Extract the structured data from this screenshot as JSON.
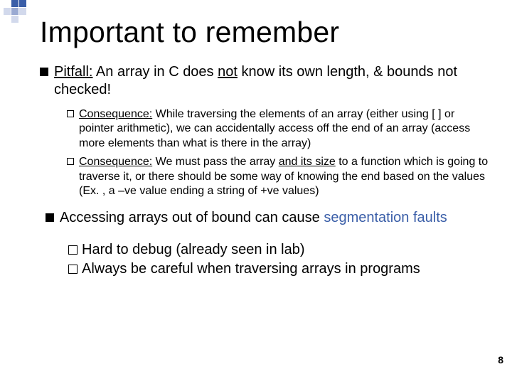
{
  "title": "Important to remember",
  "bullet1": {
    "pre": "Pitfall:",
    "mid1": " An array in C does ",
    "u1": "not",
    "mid2": " know its own length, & bounds not checked!"
  },
  "sub1": {
    "label": "Consequence:",
    "text": " While traversing the elements of an array (either using [ ] or pointer arithmetic), we can accidentally access off the end of an array (access more elements than what is there in the array)"
  },
  "sub2": {
    "label": "Consequence:",
    "pre": " We must pass the array ",
    "u": "and its size",
    "post": " to a function which is going to traverse it, or there should be some way of knowing the end based on the values (Ex. , a –ve value ending a string of +ve values)"
  },
  "bullet2": {
    "pre": " Accessing arrays out of bound can cause ",
    "link": "segmentation faults"
  },
  "sub3": {
    "text": " Hard to debug (already seen in lab)"
  },
  "sub4": {
    "text": "Always be careful when traversing arrays in programs"
  },
  "page": "8",
  "colors": {
    "link": "#3A5EA8",
    "deco1": "#3A5EA8",
    "deco2": "#9AAAD2",
    "deco3": "#D2D9EC"
  }
}
